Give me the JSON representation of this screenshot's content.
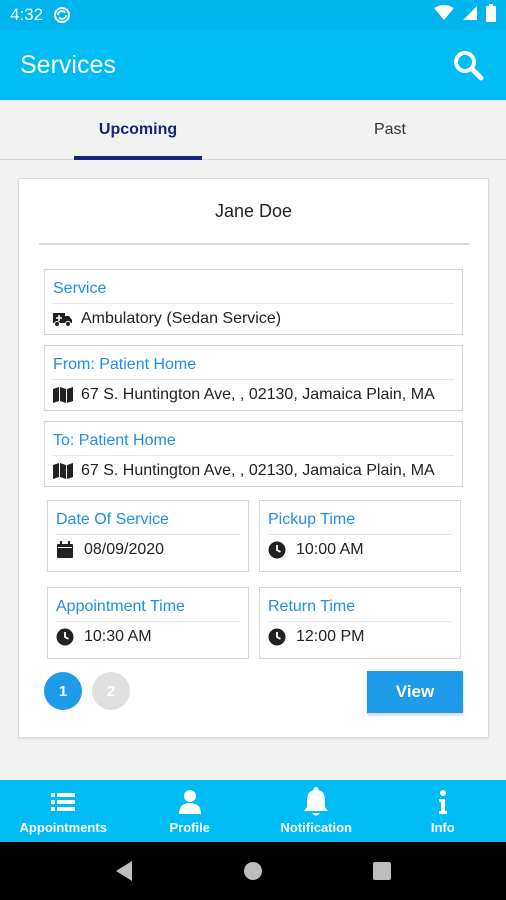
{
  "status_bar": {
    "time": "4:32"
  },
  "app_bar": {
    "title": "Services"
  },
  "tabs": [
    {
      "label": "Upcoming",
      "active": true
    },
    {
      "label": "Past",
      "active": false
    }
  ],
  "card": {
    "patient_name": "Jane Doe",
    "service": {
      "label": "Service",
      "value": "Ambulatory (Sedan Service)"
    },
    "from": {
      "label": "From: Patient Home",
      "value": "67 S. Huntington Ave, , 02130, Jamaica Plain, MA"
    },
    "to": {
      "label": "To: Patient Home",
      "value": "67 S. Huntington Ave, , 02130, Jamaica Plain, MA"
    },
    "date_of_service": {
      "label": "Date Of Service",
      "value": "08/09/2020"
    },
    "pickup_time": {
      "label": "Pickup Time",
      "value": "10:00 AM"
    },
    "appointment_time": {
      "label": "Appointment Time",
      "value": "10:30 AM"
    },
    "return_time": {
      "label": "Return Time",
      "value": "12:00 PM"
    },
    "pages": [
      "1",
      "2"
    ],
    "current_page": "1",
    "view_label": "View"
  },
  "bottom_nav": [
    {
      "label": "Appointments",
      "icon": "list-icon"
    },
    {
      "label": "Profile",
      "icon": "person-icon"
    },
    {
      "label": "Notification",
      "icon": "bell-icon"
    },
    {
      "label": "Info",
      "icon": "info-icon"
    }
  ],
  "colors": {
    "primary": "#00bcf5",
    "accent_blue": "#1e9be9",
    "label_blue": "#1e8fe6",
    "tab_indicator": "#1a237e"
  }
}
